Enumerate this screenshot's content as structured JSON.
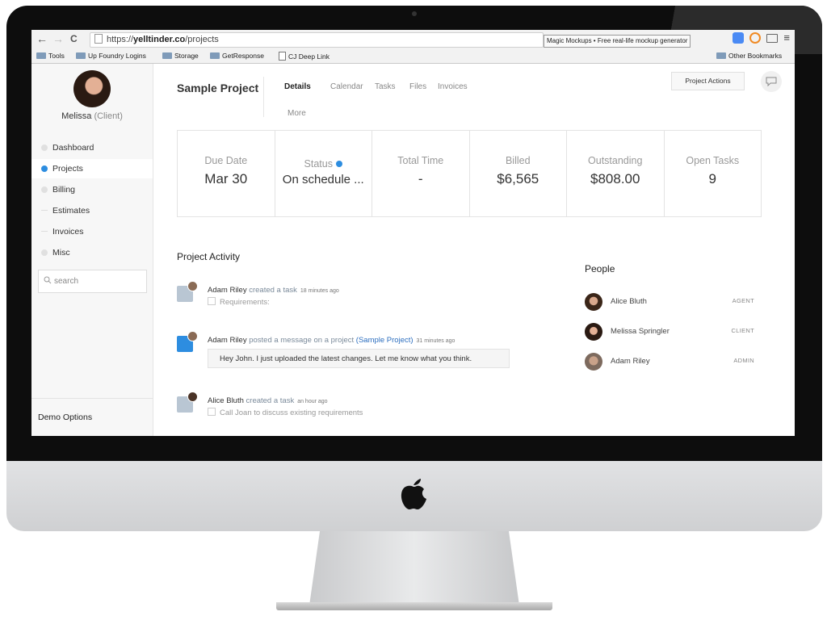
{
  "browser": {
    "url_prefix": "https://",
    "url_domain": "yelltinder.co",
    "url_path": "/projects",
    "tooltip": "Magic Mockups • Free real-life mockup generator",
    "bookmarks": [
      "Tools",
      "Up Foundry Logins",
      "Storage",
      "GetResponse",
      "CJ Deep Link",
      "Other Bookmarks"
    ]
  },
  "sidebar": {
    "user_name": "Melissa",
    "user_role": "(Client)",
    "items": [
      {
        "label": "Dashboard"
      },
      {
        "label": "Projects"
      },
      {
        "label": "Billing"
      },
      {
        "label": "Estimates"
      },
      {
        "label": "Invoices"
      },
      {
        "label": "Misc"
      }
    ],
    "search_placeholder": "search",
    "footer": "Demo Options"
  },
  "project": {
    "title": "Sample Project",
    "tabs": [
      "Details",
      "Calendar",
      "Tasks",
      "Files",
      "Invoices",
      "More"
    ],
    "actions_label": "Project Actions"
  },
  "stats": [
    {
      "label": "Due Date",
      "value": "Mar 30"
    },
    {
      "label": "Status",
      "value": "On schedule ..."
    },
    {
      "label": "Total Time",
      "value": "-"
    },
    {
      "label": "Billed",
      "value": "$6,565"
    },
    {
      "label": "Outstanding",
      "value": "$808.00"
    },
    {
      "label": "Open Tasks",
      "value": "9"
    }
  ],
  "activity": {
    "title": "Project Activity",
    "items": [
      {
        "actor": "Adam Riley",
        "verb": "created a task",
        "time": "18 minutes ago",
        "detail": "Requirements:"
      },
      {
        "actor": "Adam Riley",
        "verb": "posted a message on a project",
        "link": "(Sample Project)",
        "time": "31 minutes ago",
        "detail": "Hey John. I just uploaded the latest changes. Let me know what you think."
      },
      {
        "actor": "Alice Bluth",
        "verb": "created a task",
        "time": "an hour ago",
        "detail": "Call Joan to discuss existing requirements"
      }
    ]
  },
  "people": {
    "title": "People",
    "items": [
      {
        "name": "Alice Bluth",
        "role": "AGENT"
      },
      {
        "name": "Melissa Springler",
        "role": "CLIENT"
      },
      {
        "name": "Adam Riley",
        "role": "ADMIN"
      }
    ]
  },
  "colors": {
    "accent": "#2d8de0",
    "link": "#2d6fbf"
  }
}
